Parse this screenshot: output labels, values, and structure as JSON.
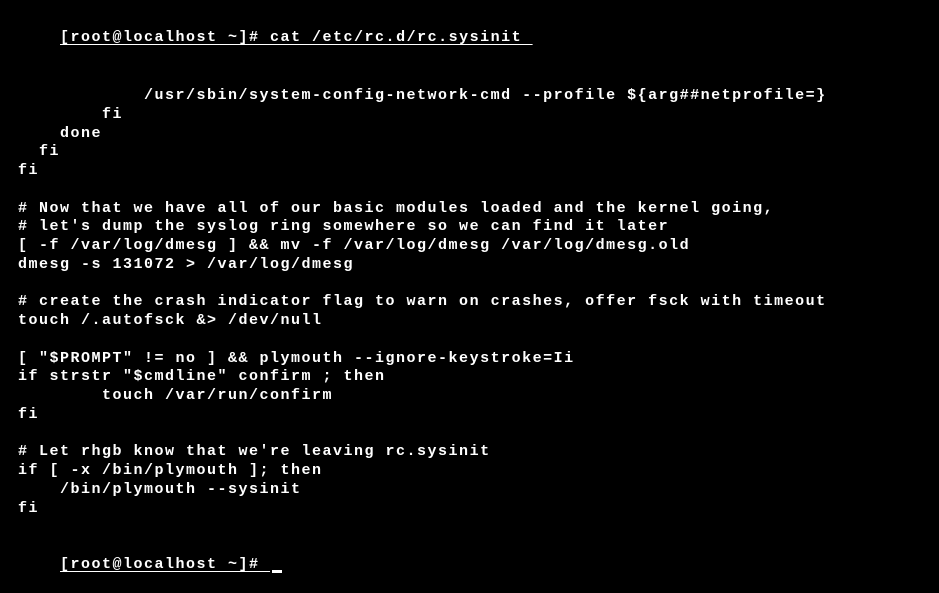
{
  "terminal": {
    "prompt1": "[root@localhost ~]# cat /etc/rc.d/rc.sysinit ",
    "lines": [
      "",
      "            /usr/sbin/system-config-network-cmd --profile ${arg##netprofile=}",
      "        fi",
      "    done",
      "  fi",
      "fi",
      "",
      "# Now that we have all of our basic modules loaded and the kernel going,",
      "# let's dump the syslog ring somewhere so we can find it later",
      "[ -f /var/log/dmesg ] && mv -f /var/log/dmesg /var/log/dmesg.old",
      "dmesg -s 131072 > /var/log/dmesg",
      "",
      "# create the crash indicator flag to warn on crashes, offer fsck with timeout",
      "touch /.autofsck &> /dev/null",
      "",
      "[ \"$PROMPT\" != no ] && plymouth --ignore-keystroke=Ii",
      "if strstr \"$cmdline\" confirm ; then",
      "        touch /var/run/confirm",
      "fi",
      "",
      "# Let rhgb know that we're leaving rc.sysinit",
      "if [ -x /bin/plymouth ]; then",
      "    /bin/plymouth --sysinit",
      "fi",
      ""
    ],
    "prompt2": "[root@localhost ~]# "
  }
}
